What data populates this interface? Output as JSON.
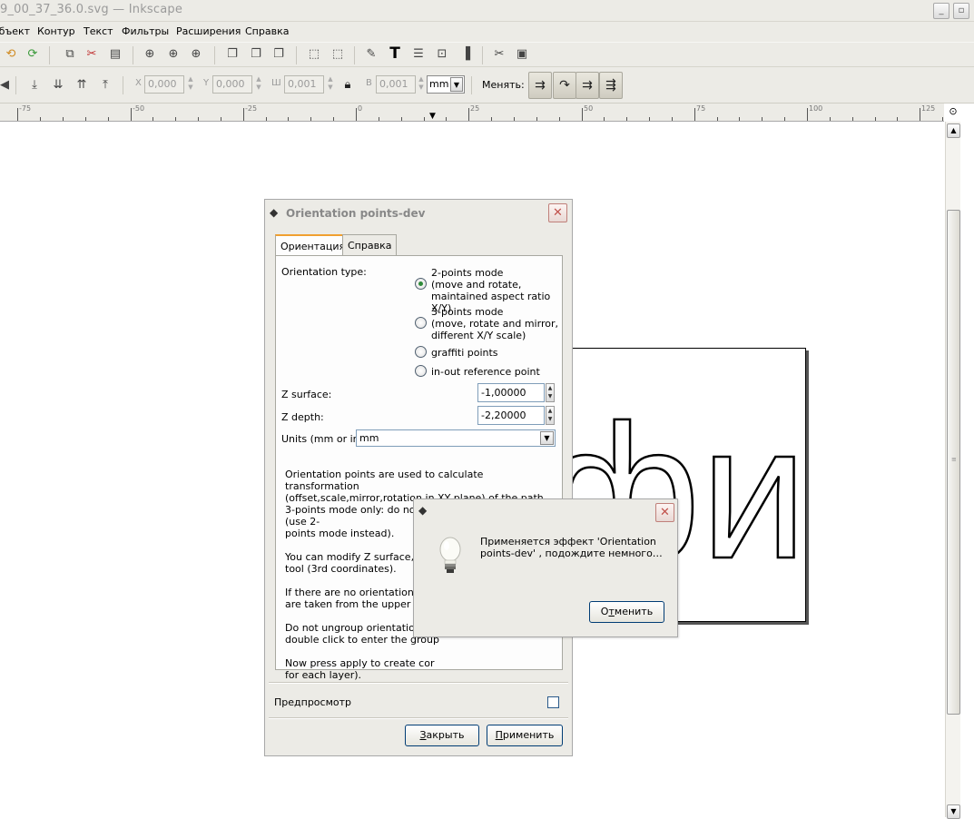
{
  "window": {
    "title": "9_00_37_36.0.svg — Inkscape"
  },
  "menu": [
    "Объект",
    "Контур",
    "Текст",
    "Фильтры",
    "Расширения",
    "Справка"
  ],
  "toolbar2": {
    "x_label": "X",
    "x_value": "0,000",
    "y_label": "Y",
    "y_value": "0,000",
    "w_label": "Ш",
    "w_value": "0,001",
    "h_label": "В",
    "h_value": "0,001",
    "unit": "mm",
    "change_label": "Менять:"
  },
  "ruler": {
    "labels": [
      "-75",
      "-50",
      "-25",
      "0",
      "25",
      "50",
      "75",
      "100",
      "125"
    ]
  },
  "canvas": {
    "art_text": "фий"
  },
  "dialog": {
    "title": "Orientation points-dev",
    "tabs": [
      "Ориентация",
      "Справка"
    ],
    "orientation_label": "Orientation type:",
    "options": [
      {
        "label": "2-points mode\n(move and rotate,\nmaintained aspect ratio X/Y)",
        "selected": true
      },
      {
        "label": "3-points mode\n(move, rotate and mirror,\ndifferent X/Y scale)",
        "selected": false
      },
      {
        "label": "graffiti points",
        "selected": false
      },
      {
        "label": "in-out reference point",
        "selected": false
      }
    ],
    "z_surface_label": "Z surface:",
    "z_surface_value": "-1,00000",
    "z_depth_label": "Z depth:",
    "z_depth_value": "-2,20000",
    "units_label": "Units (mm or in):",
    "units_value": "mm",
    "help": [
      "Orientation points are used to calculate transformation\n(offset,scale,mirror,rotation in XY plane) of the path.\n3-points mode only: do not put all three into one line (use 2-\npoints mode instead).",
      "You can modify Z surface, Z d\ntool (3rd coordinates).",
      "If there are no orientation po\nare taken from the upper laye",
      "Do not ungroup orientation po\ndouble click to enter the group",
      "Now press apply to create cor\nfor each layer)."
    ],
    "preview_label": "Предпросмотр",
    "preview_checked": false,
    "close_button": "Закрыть",
    "close_mnemonic": "З",
    "close_rest": "акрыть",
    "apply_button": "Применить",
    "apply_mnemonic": "П",
    "apply_rest": "рименить"
  },
  "progress_dialog": {
    "message": "Применяется эффект 'Orientation points-dev' , подождите немного…",
    "cancel_button": "Отменить",
    "cancel_mnemonic": "т",
    "cancel_pre": "О",
    "cancel_rest": "менить"
  },
  "colors": {
    "chrome": "#ecebe6",
    "accent_tab": "#f0a030",
    "radio_dot": "#2e8a3a",
    "close_red": "#c0504a"
  }
}
